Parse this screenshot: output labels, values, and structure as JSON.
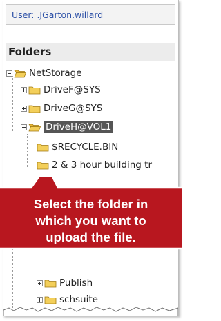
{
  "user_bar": {
    "text": "User: .JGarton.willard"
  },
  "folders": {
    "heading": "Folders",
    "items": [
      {
        "label": "NetStorage"
      },
      {
        "label": "DriveF@SYS"
      },
      {
        "label": "DriveG@SYS"
      },
      {
        "label": "DriveH@VOL1"
      },
      {
        "label": "$RECYCLE.BIN"
      },
      {
        "label": "2 & 3 hour building tr"
      },
      {
        "label": "Publish"
      },
      {
        "label": "schsuite"
      }
    ]
  },
  "callout": {
    "lines": [
      "Select the folder in",
      "which you want to",
      "upload the file."
    ]
  },
  "colors": {
    "callout_red": "#b8171f",
    "selection": "#555555",
    "user_text": "#2b4fa6",
    "folder_yellow": "#f3cf5a"
  }
}
